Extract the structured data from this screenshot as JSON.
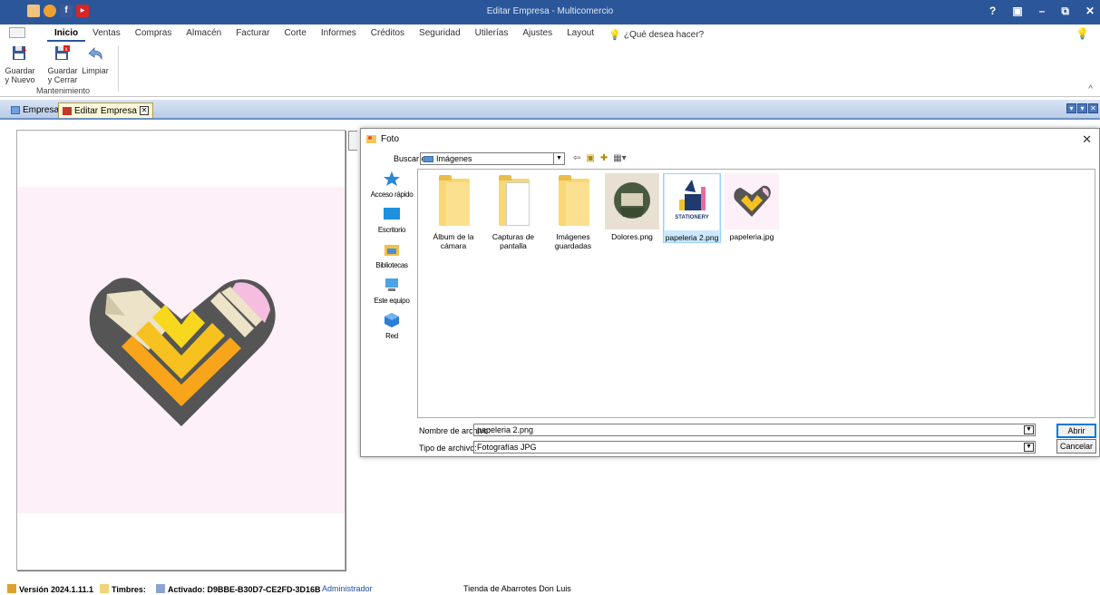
{
  "window": {
    "title": "Editar Empresa - Multicomercio",
    "controls": [
      "?",
      "▣",
      "–",
      "⧉",
      "✕"
    ]
  },
  "menu": {
    "items": [
      "Inicio",
      "Ventas",
      "Compras",
      "Almacén",
      "Facturar",
      "Corte",
      "Informes",
      "Créditos",
      "Seguridad",
      "Utilerías",
      "Ajustes",
      "Layout"
    ],
    "active": "Inicio",
    "tell_me": "¿Qué desea hacer?"
  },
  "ribbon": {
    "save_new": "Guardar\ny Nuevo",
    "save_close": "Guardar\ny Cerrar",
    "clear": "Limpiar",
    "group": "Mantenimiento"
  },
  "doc_tabs": {
    "tab1": "Empresas",
    "tab2": "Editar Empresa"
  },
  "dialog": {
    "title": "Foto",
    "look_in_label": "Buscar en:",
    "look_in_value": "Imágenes",
    "places": [
      "Acceso rápido",
      "Escritorio",
      "Bibliotecas",
      "Este equipo",
      "Red"
    ],
    "files": [
      {
        "name": "Álbum de la cámara",
        "kind": "folder"
      },
      {
        "name": "Capturas de pantalla",
        "kind": "folder"
      },
      {
        "name": "Imágenes guardadas",
        "kind": "folder"
      },
      {
        "name": "Dolores.png",
        "kind": "image"
      },
      {
        "name": "papeleria 2.png",
        "kind": "image",
        "selected": true,
        "thumb_text": "STATIONERY"
      },
      {
        "name": "papeleria.jpg",
        "kind": "image"
      }
    ],
    "filename_label": "Nombre de archivo:",
    "filename_value": "papeleria 2.png",
    "filetype_label": "Tipo de archivo:",
    "filetype_value": "Fotografías JPG",
    "open": "Abrir",
    "cancel": "Cancelar"
  },
  "status": {
    "version": "Versión 2024.1.11.1",
    "stamps": "Timbres:",
    "activated": "Activado: D9BBE-B30D7-CE2FD-3D16B",
    "user": "Administrador",
    "store": "Tienda de Abarrotes Don Luis"
  },
  "colors": {
    "titlebar": "#2b579a",
    "accent": "#2b579a",
    "selection": "#cce8ff"
  }
}
